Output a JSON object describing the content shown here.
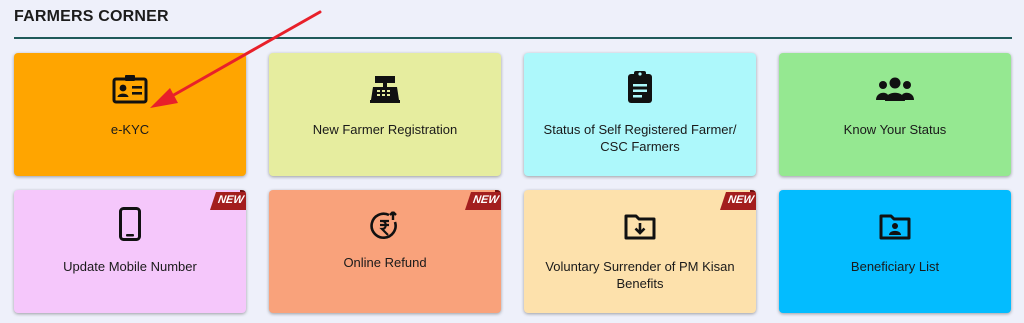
{
  "section": {
    "title": "FARMERS CORNER"
  },
  "colors": {
    "rule": "#1f5a5a",
    "arrow": "#e8202a",
    "ribbon": "#a31e1e",
    "ribbon_dark": "#6e0f0f"
  },
  "cards": [
    {
      "label": "e-KYC",
      "icon": "id-card-icon",
      "color": "#ffa500",
      "is_new": false
    },
    {
      "label": "New Farmer Registration",
      "icon": "cash-register-icon",
      "color": "#e6ed9f",
      "is_new": false
    },
    {
      "label": "Status of Self Registered Farmer/ CSC Farmers",
      "icon": "clipboard-icon",
      "color": "#adf8fb",
      "is_new": false
    },
    {
      "label": "Know Your Status",
      "icon": "group-icon",
      "color": "#95e891",
      "is_new": false
    },
    {
      "label": "Update Mobile Number",
      "icon": "mobile-phone-icon",
      "color": "#f5c7fb",
      "is_new": true
    },
    {
      "label": "Online Refund",
      "icon": "rupee-refund-icon",
      "color": "#f9a27b",
      "is_new": true
    },
    {
      "label": "Voluntary Surrender of PM Kisan Benefits",
      "icon": "folder-download-icon",
      "color": "#fde1ac",
      "is_new": true
    },
    {
      "label": "Beneficiary List",
      "icon": "folder-user-icon",
      "color": "#03bcff",
      "is_new": false
    }
  ],
  "badge": {
    "new_label": "NEW"
  }
}
